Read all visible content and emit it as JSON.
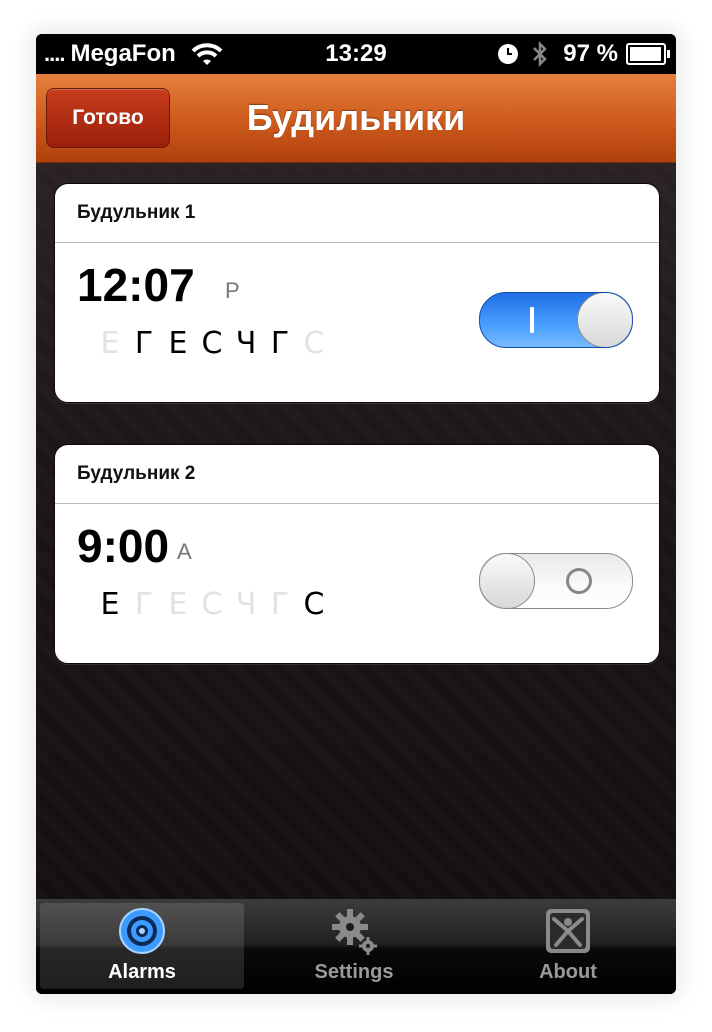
{
  "status_bar": {
    "signal": "....",
    "carrier": "MegaFon",
    "time": "13:29",
    "battery": "97 %"
  },
  "nav": {
    "done_label": "Готово",
    "title": "Будильники"
  },
  "alarms": [
    {
      "name": "Будульник 1",
      "time": "12:07",
      "ampm": "P",
      "enabled": true,
      "days": [
        {
          "char": "Е",
          "active": false
        },
        {
          "char": "Г",
          "active": true
        },
        {
          "char": "Е",
          "active": true
        },
        {
          "char": "С",
          "active": true
        },
        {
          "char": "Ч",
          "active": true
        },
        {
          "char": "Г",
          "active": true
        },
        {
          "char": "С",
          "active": false
        }
      ]
    },
    {
      "name": "Будульник 2",
      "time": "9:00",
      "ampm": "A",
      "enabled": false,
      "days": [
        {
          "char": "Е",
          "active": true
        },
        {
          "char": "Г",
          "active": false
        },
        {
          "char": "Е",
          "active": false
        },
        {
          "char": "С",
          "active": false
        },
        {
          "char": "Ч",
          "active": false
        },
        {
          "char": "Г",
          "active": false
        },
        {
          "char": "С",
          "active": true
        }
      ]
    }
  ],
  "tabs": [
    {
      "label": "Alarms",
      "icon": "target-icon",
      "active": true
    },
    {
      "label": "Settings",
      "icon": "gears-icon",
      "active": false
    },
    {
      "label": "About",
      "icon": "about-icon",
      "active": false
    }
  ],
  "colors": {
    "nav_orange": "#cf5d1e",
    "switch_blue": "#2b7df0",
    "tab_active_blue": "#3d9bff"
  }
}
